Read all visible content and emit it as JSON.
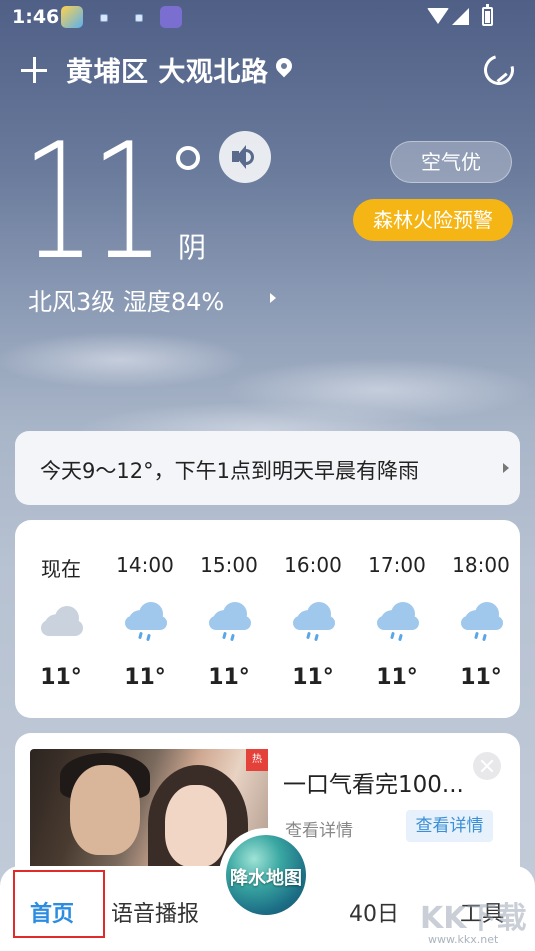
{
  "status_bar": {
    "time": "1:46"
  },
  "header": {
    "location": "黄埔区 大观北路"
  },
  "current": {
    "temperature": "11",
    "condition": "阴",
    "wind_humidity": "北风3级  湿度84%",
    "air_quality": "空气优",
    "warning": "森林火险预警"
  },
  "summary": {
    "text": "今天9～12°，下午1点到明天早晨有降雨"
  },
  "hourly": [
    {
      "time": "现在",
      "temp": "11°",
      "icon": "cloudy-icon"
    },
    {
      "time": "14:00",
      "temp": "11°",
      "icon": "rain-icon"
    },
    {
      "time": "15:00",
      "temp": "11°",
      "icon": "rain-icon"
    },
    {
      "time": "16:00",
      "temp": "11°",
      "icon": "rain-icon"
    },
    {
      "time": "17:00",
      "temp": "11°",
      "icon": "rain-icon"
    },
    {
      "time": "18:00",
      "temp": "11°",
      "icon": "rain-icon"
    }
  ],
  "ad": {
    "title": "一口气看完100...",
    "subtitle": "查看详情",
    "button": "查看详情",
    "tag": "热"
  },
  "nav": {
    "home": "首页",
    "voice": "语音播报",
    "map": "降水地图",
    "forty_day": "40日",
    "tools": "工具"
  },
  "watermark": {
    "logo": "KK下载",
    "url": "www.kkx.net"
  },
  "colors": {
    "accent": "#2c8de0",
    "warning": "#f5b514",
    "highlight_box": "#e02b2b"
  }
}
